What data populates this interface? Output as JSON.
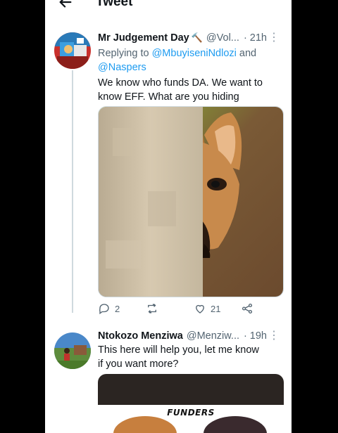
{
  "header": {
    "title": "Tweet",
    "back_icon": "back-arrow-icon"
  },
  "tweets": [
    {
      "name": "Mr Judgement Day",
      "name_emoji": "🔨",
      "handle": "@Vol...",
      "time": "· 21h",
      "replying_prefix": "Replying to",
      "replying_users": [
        "@MbuyiseniNdlozi",
        "@Naspers"
      ],
      "replying_joiner": "and",
      "text": "We know who funds DA. We want to know EFF. What are you hiding",
      "media_description": "dog peeking from behind a wall",
      "stats": {
        "replies": "2",
        "retweets": "",
        "likes": "21"
      }
    },
    {
      "name": "Ntokozo Menziwa",
      "handle": "@Menziw...",
      "time": "· 19h",
      "text": "This here will help you, let me know if you want more?",
      "media_caption": "FUNDERS"
    }
  ],
  "colors": {
    "accent": "#1d9bf0",
    "muted": "#536471",
    "line": "#cfd9de"
  }
}
